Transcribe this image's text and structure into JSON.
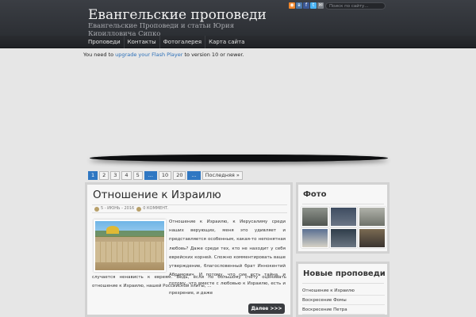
{
  "header": {
    "title": "Евангельские проповеди",
    "description": "Евангельские Проповеди и статьи Юрия Кирилловича Сипко",
    "search_placeholder": "Поиск по сайту...",
    "social_icons": [
      {
        "name": "rss-icon",
        "color": "#f0862b"
      },
      {
        "name": "vkontakte-icon",
        "color": "#4a76a8"
      },
      {
        "name": "facebook-icon",
        "color": "#3b5998"
      },
      {
        "name": "twitter-icon",
        "color": "#4ab3f4"
      },
      {
        "name": "mail-icon",
        "color": "#7a7f86"
      }
    ]
  },
  "nav": {
    "items": [
      "Проповеди",
      "Контакты",
      "Фотогалерея",
      "Карта сайта"
    ]
  },
  "flash_notice": {
    "before": "You need to ",
    "link": "upgrade your Flash Player",
    "after": " to version 10 or newer."
  },
  "pagination": {
    "pages": [
      "1",
      "2",
      "3",
      "4",
      "5",
      "...",
      "10",
      "20",
      "...",
      "Последняя »"
    ],
    "active": "1"
  },
  "article": {
    "title": "Отношение к Израилю",
    "date": "5 - ИЮНЬ - 2016",
    "comments": "0 КОММЕНТ.",
    "text_right": "Отношение к Израилю, к Иерусалиму среди наших верующих, меня это удивляет и представляется особенным, какая-то непонятная любовь? Даже среди тех, кто не находит у себя еврейских корней. Сложно комментировать ваше утверждение, благословенный брат Иннокентий Абрамович. И потому, что сие есть тайна, и потому, что вместе с любовью к Израилю, есть и презрение, и даже",
    "text_bottom": "случается ненависть к евреям. Ведь, если по большому счёту оценивать отношение к Израилю, нашей Российской элиты,  ...",
    "more_label": "Далее >>>"
  },
  "sidebar": {
    "photo": {
      "title": "Фото",
      "thumbs": [
        "#6a6e6a",
        "#4f5d6e",
        "#8b8f86",
        "#5d6f8a",
        "#44525f",
        "#6d6250"
      ]
    },
    "new_posts": {
      "title": "Новые проповеди",
      "items": [
        "Отношение к Израилю",
        "Воскресение Фомы",
        "Воскресение Петра"
      ]
    }
  }
}
